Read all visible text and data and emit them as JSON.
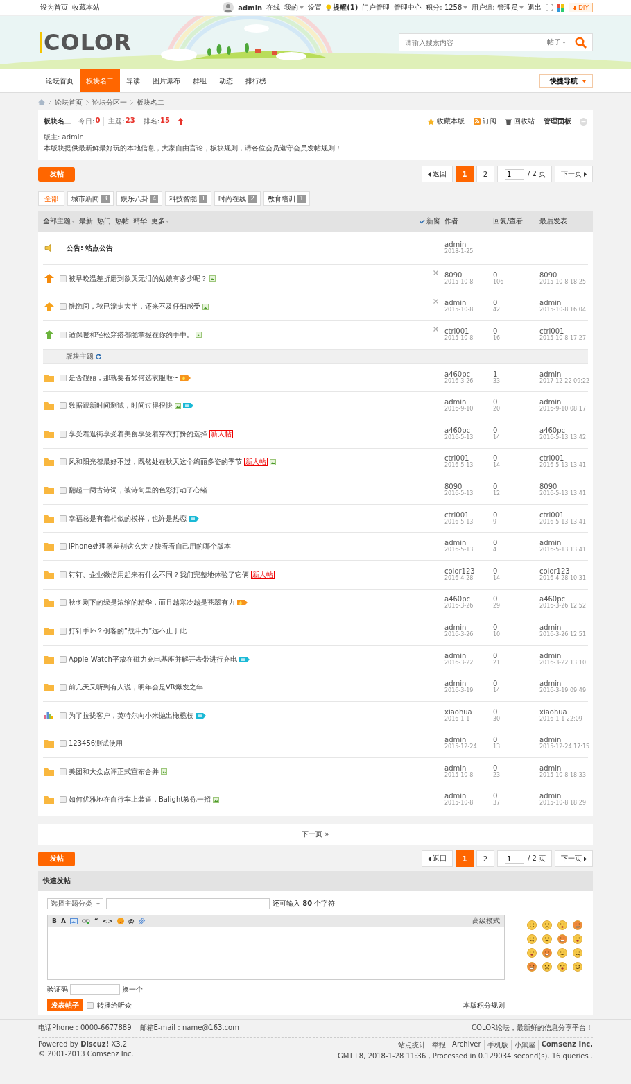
{
  "topbar": {
    "links": [
      "设为首页",
      "收藏本站"
    ],
    "username": "admin",
    "items": [
      {
        "kind": "plain",
        "label": "在线"
      },
      {
        "kind": "dropdown",
        "label": "我的"
      },
      {
        "kind": "plain",
        "label": "设置"
      },
      {
        "kind": "notice",
        "label": "提醒(1)"
      },
      {
        "kind": "plain",
        "label": "门户管理"
      },
      {
        "kind": "plain",
        "label": "管理中心"
      },
      {
        "kind": "dropdown",
        "label": "积分: 1258"
      },
      {
        "kind": "dropdown",
        "label": "用户组: 管理员"
      },
      {
        "kind": "plain",
        "label": "退出"
      }
    ],
    "diy": "DIY"
  },
  "header": {
    "logo": "COLOR",
    "search": {
      "placeholder": "请输入搜索内容",
      "scope": "帖子"
    }
  },
  "nav": {
    "items": [
      {
        "label": "论坛首页",
        "selected": false
      },
      {
        "label": "板块名二",
        "selected": true
      },
      {
        "label": "导读",
        "selected": false
      },
      {
        "label": "图片瀑布",
        "selected": false
      },
      {
        "label": "群组",
        "selected": false
      },
      {
        "label": "动态",
        "selected": false
      },
      {
        "label": "排行榜",
        "selected": false
      }
    ],
    "quick_nav": "快捷导航"
  },
  "breadcrumb": [
    "论坛首页",
    "论坛分区一",
    "板块名二"
  ],
  "forum": {
    "name": "板块名二",
    "stats": [
      {
        "label": "今日:",
        "value": "0"
      },
      {
        "label": "主题:",
        "value": "23"
      },
      {
        "label": "排名:",
        "value": "15"
      }
    ],
    "actions": [
      {
        "kind": "star",
        "label": "收藏本版"
      },
      {
        "kind": "rss",
        "label": "订阅"
      },
      {
        "kind": "trash",
        "label": "回收站"
      },
      {
        "kind": "panel",
        "label": "管理面板"
      }
    ],
    "moderator": "版主: admin",
    "description": "本版块提供最新鲜最好玩的本地信息，大家自由言论，板块规则，请各位会员遵守会员发帖规则！"
  },
  "top_toolbar": {
    "post_button": "发帖",
    "pager": {
      "back": "返回",
      "pages": [
        {
          "label": "1",
          "selected": true
        },
        {
          "label": "2",
          "selected": false
        }
      ],
      "jump_value": "1",
      "total": "/ 2 页",
      "next": "下一页"
    }
  },
  "categories": [
    {
      "label": "全部",
      "selected": true
    },
    {
      "label": "城市新闻",
      "count": "3",
      "selected": false
    },
    {
      "label": "娱乐八卦",
      "count": "4",
      "selected": false
    },
    {
      "label": "科技智能",
      "count": "1",
      "selected": false
    },
    {
      "label": "时尚在线",
      "count": "2",
      "selected": false
    },
    {
      "label": "教育培训",
      "count": "1",
      "selected": false
    }
  ],
  "thread_list": {
    "filters": [
      {
        "label": "全部主题",
        "dropdown": true
      },
      {
        "label": "最新",
        "dropdown": false
      },
      {
        "label": "热门",
        "dropdown": false
      },
      {
        "label": "热帖",
        "dropdown": false
      },
      {
        "label": "精华",
        "dropdown": false
      },
      {
        "label": "更多",
        "dropdown": true
      }
    ],
    "new_window": {
      "label": "新窗",
      "checked": true
    },
    "columns": [
      "作者",
      "回复/查看",
      "最后发表"
    ],
    "announcement": {
      "label": "公告: 站点公告",
      "author": "admin",
      "date": "2018-1-25"
    },
    "sticky_threads": [
      {
        "kind": "stick3",
        "title": "被早晚温差折磨到欲哭无泪的姑娘有多少呢？",
        "badges": [
          {
            "kind": "image"
          }
        ],
        "author": "8090",
        "date": "2015-10-8",
        "replies": "0",
        "views": "106",
        "last_author": "8090",
        "last_time": "2015-10-8 18:25",
        "closable": true,
        "checked": false
      },
      {
        "kind": "stick2",
        "title": "恍惚间，秋已溜走大半，还来不及仔细感受",
        "badges": [
          {
            "kind": "image"
          }
        ],
        "author": "admin",
        "date": "2015-10-8",
        "replies": "0",
        "views": "42",
        "last_author": "admin",
        "last_time": "2015-10-8 16:04",
        "closable": true,
        "checked": false
      },
      {
        "kind": "stick1",
        "title": "适保暖和轻松穿搭都能掌握在你的手中。",
        "badges": [
          {
            "kind": "image"
          }
        ],
        "author": "ctrl001",
        "date": "2015-10-8",
        "replies": "0",
        "views": "16",
        "last_author": "ctrl001",
        "last_time": "2015-10-8 17:27",
        "closable": true,
        "checked": false
      }
    ],
    "section_title": "版块主题",
    "threads": [
      {
        "kind": "folder",
        "title": "是否靓丽，那就要看如何选衣服啦~",
        "badges": [
          {
            "kind": "hot"
          }
        ],
        "author": "a460pc",
        "date": "2016-3-26",
        "replies": "1",
        "views": "33",
        "last_author": "admin",
        "last_time": "2017-12-22 09:22",
        "closable": false,
        "checked": false
      },
      {
        "kind": "folder",
        "title": "数据跟新时间测试，时间过得很快",
        "badges": [
          {
            "kind": "image"
          },
          {
            "kind": "new"
          }
        ],
        "author": "admin",
        "date": "2016-9-10",
        "replies": "0",
        "views": "20",
        "last_author": "admin",
        "last_time": "2016-9-10 08:17",
        "closable": false,
        "checked": false
      },
      {
        "kind": "folder",
        "title": "享受着逛街享受着美食享受着穿衣打扮的选择",
        "badges": [
          {
            "kind": "newbie",
            "label": "新人帖"
          }
        ],
        "author": "a460pc",
        "date": "2016-5-13",
        "replies": "0",
        "views": "14",
        "last_author": "a460pc",
        "last_time": "2016-5-13 13:42",
        "closable": false,
        "checked": false
      },
      {
        "kind": "folder",
        "title": "风和阳光都最好不过，既然处在秋天这个绚丽多姿的季节",
        "badges": [
          {
            "kind": "newbie",
            "label": "新人帖"
          },
          {
            "kind": "image"
          }
        ],
        "author": "ctrl001",
        "date": "2016-5-13",
        "replies": "0",
        "views": "14",
        "last_author": "ctrl001",
        "last_time": "2016-5-13 13:41",
        "closable": false,
        "checked": false
      },
      {
        "kind": "folder",
        "title": "翻起一阕古诗词，被诗句里的色彩打动了心绪",
        "author": "8090",
        "date": "2016-5-13",
        "replies": "0",
        "views": "12",
        "last_author": "8090",
        "last_time": "2016-5-13 13:41",
        "closable": false,
        "checked": false
      },
      {
        "kind": "folder",
        "title": "幸福总是有着相似的模样，也许是热恋",
        "badges": [
          {
            "kind": "new"
          }
        ],
        "author": "ctrl001",
        "date": "2016-5-13",
        "replies": "0",
        "views": "9",
        "last_author": "ctrl001",
        "last_time": "2016-5-13 13:41",
        "closable": false,
        "checked": false
      },
      {
        "kind": "folder",
        "title": "iPhone处理器差别这么大？快看看自己用的哪个版本",
        "author": "admin",
        "date": "2016-5-13",
        "replies": "0",
        "views": "4",
        "last_author": "admin",
        "last_time": "2016-5-13 13:41",
        "closable": false,
        "checked": false
      },
      {
        "kind": "folder",
        "title": "钉钉、企业微信用起来有什么不同？我们完整地体验了它俩",
        "badges": [
          {
            "kind": "newbie",
            "label": "新人帖"
          }
        ],
        "author": "color123",
        "date": "2016-4-28",
        "replies": "0",
        "views": "14",
        "last_author": "color123",
        "last_time": "2016-4-28 10:31",
        "closable": false,
        "checked": false
      },
      {
        "kind": "folder",
        "title": "秋冬剩下的绿是浓缩的精华，而且越寒冷越是苍翠有力",
        "badges": [
          {
            "kind": "hot"
          }
        ],
        "author": "a460pc",
        "date": "2016-3-26",
        "replies": "0",
        "views": "29",
        "last_author": "a460pc",
        "last_time": "2016-3-26 12:52",
        "closable": false,
        "checked": false
      },
      {
        "kind": "folder",
        "title": "打针手环？创客的“战斗力”远不止于此",
        "author": "admin",
        "date": "2016-3-26",
        "replies": "0",
        "views": "10",
        "last_author": "admin",
        "last_time": "2016-3-26 12:51",
        "closable": false,
        "checked": false
      },
      {
        "kind": "folder",
        "title": "Apple Watch平放在磁力充电基座并解开表带进行充电",
        "badges": [
          {
            "kind": "new"
          }
        ],
        "author": "admin",
        "date": "2016-3-22",
        "replies": "0",
        "views": "21",
        "last_author": "admin",
        "last_time": "2016-3-22 13:10",
        "closable": false,
        "checked": false
      },
      {
        "kind": "folder",
        "title": "前几天又听到有人说，明年会是VR爆发之年",
        "author": "admin",
        "date": "2016-3-19",
        "replies": "0",
        "views": "14",
        "last_author": "admin",
        "last_time": "2016-3-19 09:49",
        "closable": false,
        "checked": false
      },
      {
        "kind": "poll",
        "title": "为了拉拢客户，英特尔向小米抛出橄榄枝",
        "badges": [
          {
            "kind": "new"
          }
        ],
        "author": "xiaohua",
        "date": "2016-1-1",
        "replies": "0",
        "views": "30",
        "last_author": "xiaohua",
        "last_time": "2016-1-1 22:09",
        "closable": false,
        "checked": false
      },
      {
        "kind": "folder",
        "title": "123456测试使用",
        "author": "admin",
        "date": "2015-12-24",
        "replies": "0",
        "views": "13",
        "last_author": "admin",
        "last_time": "2015-12-24 17:15",
        "closable": false,
        "checked": false
      },
      {
        "kind": "folder",
        "title": "美团和大众点评正式宣布合并",
        "badges": [
          {
            "kind": "image"
          }
        ],
        "author": "admin",
        "date": "2015-10-8",
        "replies": "0",
        "views": "23",
        "last_author": "admin",
        "last_time": "2015-10-8 18:33",
        "closable": false,
        "checked": false
      },
      {
        "kind": "folder",
        "title": "如何优雅地在自行车上装逼，Balight教你一招",
        "badges": [
          {
            "kind": "image"
          }
        ],
        "author": "admin",
        "date": "2015-10-8",
        "replies": "0",
        "views": "37",
        "last_author": "admin",
        "last_time": "2015-10-8 18:29",
        "closable": false,
        "checked": false
      }
    ]
  },
  "next_page": "下一页 »",
  "bottom_toolbar": {
    "post_button": "发帖",
    "pager": {
      "back": "返回",
      "pages": [
        {
          "label": "1",
          "selected": true
        },
        {
          "label": "2",
          "selected": false
        }
      ],
      "jump_value": "1",
      "total": "/ 2 页",
      "next": "下一页"
    }
  },
  "quick_post": {
    "title": "快速发帖",
    "category_select": "选择主题分类",
    "remaining": "还可输入 **80** 个字符",
    "toolbar": [
      {
        "kind": "text",
        "label": "B"
      },
      {
        "kind": "text",
        "label": "A"
      },
      {
        "kind": "image"
      },
      {
        "kind": "link"
      },
      {
        "kind": "text",
        "label": "“"
      },
      {
        "kind": "text",
        "label": "<>"
      },
      {
        "kind": "smiley"
      },
      {
        "kind": "text",
        "label": "@"
      },
      {
        "kind": "attach"
      }
    ],
    "advanced": "高级模式",
    "captcha_label": "验证码",
    "captcha_refresh": "换一个",
    "submit": "发表帖子",
    "broadcast": {
      "label": "转播给听众",
      "checked": false
    },
    "rules": "本版积分规则"
  },
  "footer": {
    "phone": "电话Phone：0000-6677889",
    "email": "邮箱E-mail：name@163.com",
    "slogan": "COLOR论坛，最新鲜的信息分享平台！",
    "powered": "Powered by **Discuz!** X3.2",
    "copyright": "© 2001-2013 Comsenz Inc.",
    "links": [
      {
        "label": "站点统计",
        "bold": false
      },
      {
        "label": "举报",
        "bold": false
      },
      {
        "label": "Archiver",
        "bold": false
      },
      {
        "label": "手机版",
        "bold": false
      },
      {
        "label": "小黑屋",
        "bold": false
      },
      {
        "label": "Comsenz Inc.",
        "bold": true
      }
    ],
    "stats": "GMT+8, 2018-1-28 11:36 , Processed in 0.129034 second(s), 16 queries ."
  }
}
